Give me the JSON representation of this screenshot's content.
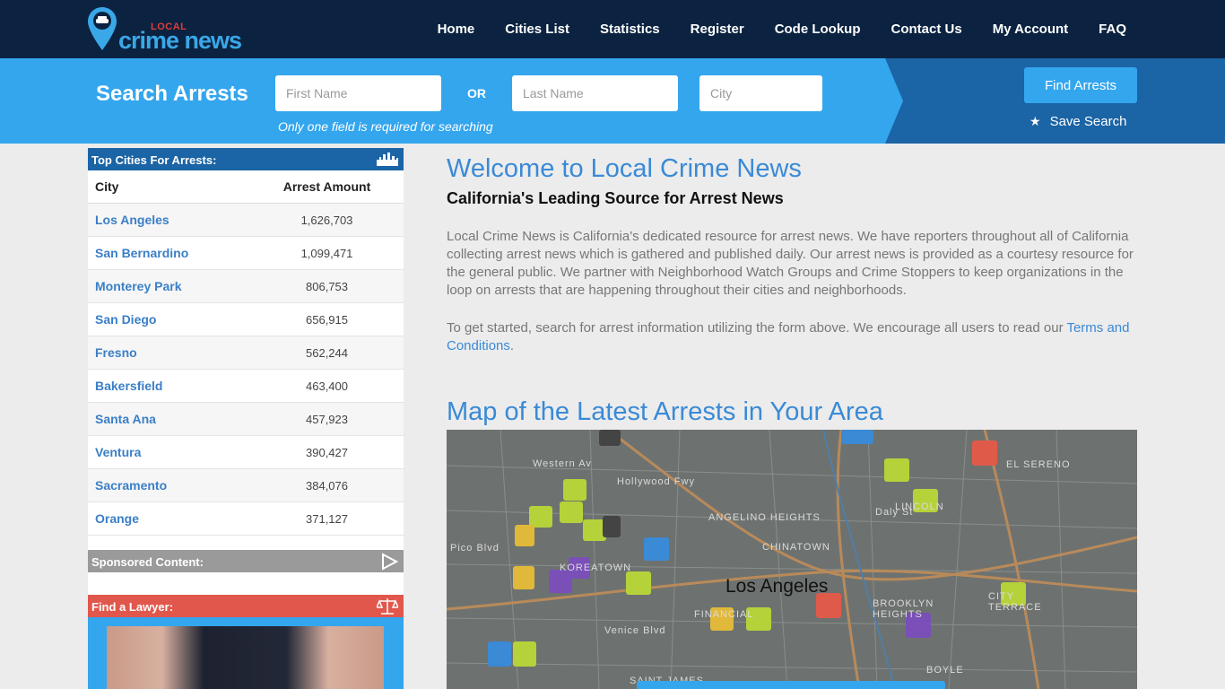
{
  "brand": {
    "local": "LOCAL",
    "name": "crime news"
  },
  "nav": [
    "Home",
    "Cities List",
    "Statistics",
    "Register",
    "Code Lookup",
    "Contact Us",
    "My Account",
    "FAQ"
  ],
  "search": {
    "title": "Search Arrests",
    "first_placeholder": "First Name",
    "or": "OR",
    "last_placeholder": "Last Name",
    "city_placeholder": "City",
    "hint": "Only one field is required for searching",
    "find_label": "Find Arrests",
    "save_label": "Save Search"
  },
  "sidebar": {
    "top_cities_title": "Top Cities For Arrests:",
    "col_city": "City",
    "col_amount": "Arrest Amount",
    "rows": [
      {
        "city": "Los Angeles",
        "amount": "1,626,703"
      },
      {
        "city": "San Bernardino",
        "amount": "1,099,471"
      },
      {
        "city": "Monterey Park",
        "amount": "806,753"
      },
      {
        "city": "San Diego",
        "amount": "656,915"
      },
      {
        "city": "Fresno",
        "amount": "562,244"
      },
      {
        "city": "Bakersfield",
        "amount": "463,400"
      },
      {
        "city": "Santa Ana",
        "amount": "457,923"
      },
      {
        "city": "Ventura",
        "amount": "390,427"
      },
      {
        "city": "Sacramento",
        "amount": "384,076"
      },
      {
        "city": "Orange",
        "amount": "371,127"
      }
    ],
    "sponsored_title": "Sponsored Content:",
    "lawyer_title": "Find a Lawyer:"
  },
  "main": {
    "title": "Welcome to Local Crime News",
    "subtitle": "California's Leading Source for Arrest News",
    "para1": "Local Crime News is California's dedicated resource for arrest news. We have reporters throughout all of California collecting arrest news which is gathered and published daily. Our arrest news is provided as a courtesy resource for the general public. We partner with Neighborhood Watch Groups and Crime Stoppers to keep organizations in the loop on arrests that are happening throughout their cities and neighborhoods.",
    "para2_before": "To get started, search for arrest information utilizing the form above. We encourage all users to read our ",
    "para2_link": "Terms and Conditions",
    "para2_after": ".",
    "map_title": "Map of the Latest Arrests in Your Area"
  },
  "map": {
    "city": "Los Angeles",
    "labels": [
      "ANGELINO HEIGHTS",
      "CHINATOWN",
      "LINCOLN",
      "EL SERENO",
      "BROOKLYN HEIGHTS",
      "BOYLE",
      "Hollywood Fwy",
      "Western Av",
      "Venice Blvd",
      "Daly St",
      "CITY TERRACE",
      "FINANCIAL",
      "SAINT JAMES",
      "KOREATOWN",
      "Pico Blvd"
    ]
  },
  "colors": {
    "topbar": "#0b2340",
    "accent": "#34a6ee",
    "dark_blue": "#1b64a5",
    "link": "#3a8ad6",
    "lawyer": "#e1574c"
  }
}
